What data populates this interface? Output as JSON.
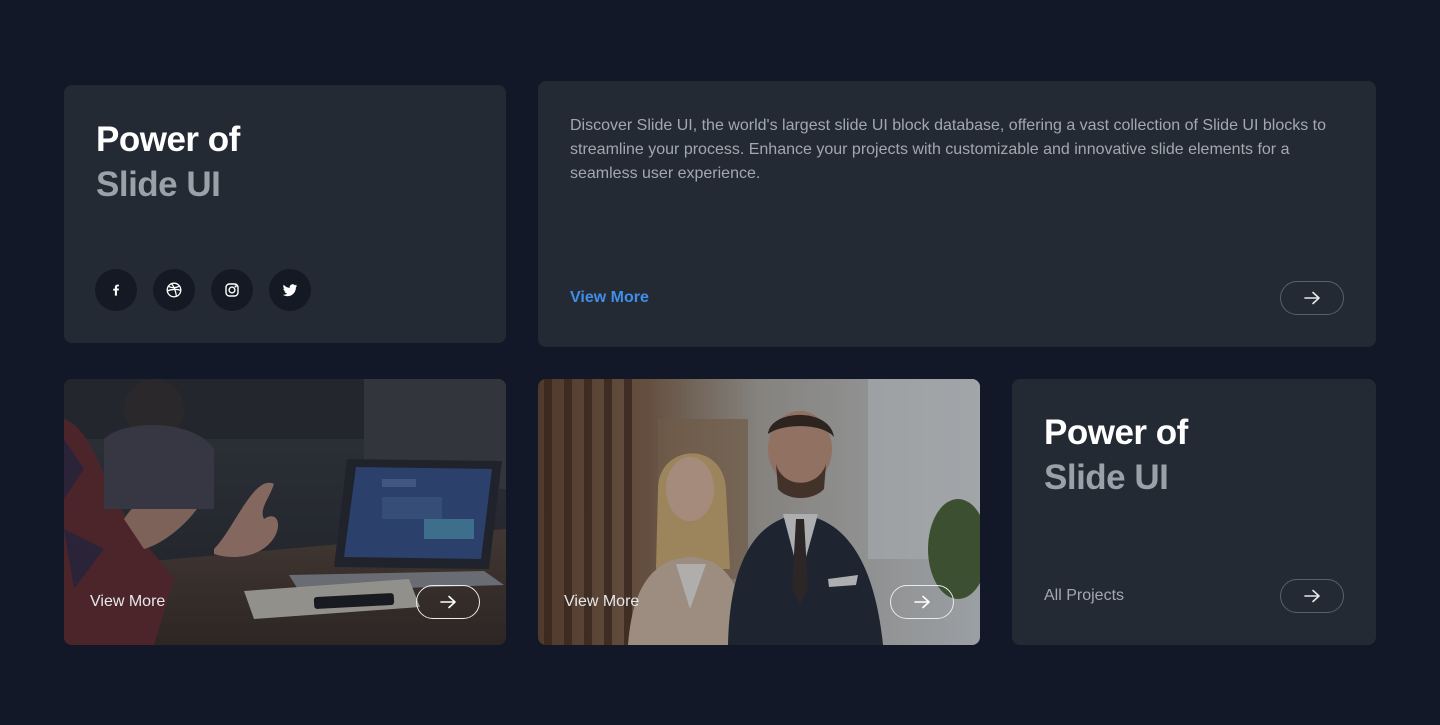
{
  "hero_card": {
    "title_line1": "Power of",
    "title_line2": "Slide UI",
    "socials": [
      {
        "name": "facebook-icon"
      },
      {
        "name": "dribbble-icon"
      },
      {
        "name": "instagram-icon"
      },
      {
        "name": "twitter-icon"
      }
    ]
  },
  "description_card": {
    "text": "Discover Slide UI, the world's largest slide UI block database, offering a vast collection of Slide UI blocks to streamline your process. Enhance your projects with customizable and innovative slide elements for a seamless user experience.",
    "link_label": "View More"
  },
  "image_cards": [
    {
      "caption": "View More",
      "scene": "team meeting with laptop"
    },
    {
      "caption": "View More",
      "scene": "business man and woman portrait"
    }
  ],
  "projects_card": {
    "title_line1": "Power of",
    "title_line2": "Slide UI",
    "link_label": "All Projects"
  },
  "colors": {
    "background": "#121828",
    "card": "#242a33",
    "accent": "#3f8ee8",
    "title": "#ffffff",
    "title_muted": "#9ba1a9"
  }
}
